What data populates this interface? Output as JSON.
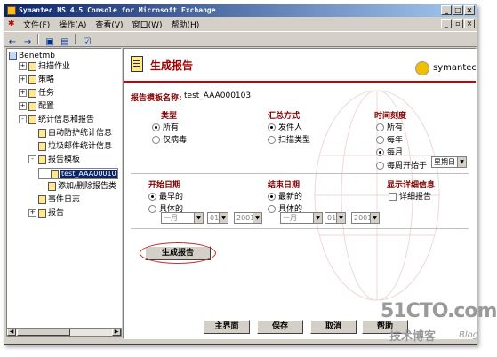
{
  "window": {
    "title": "Symantec MS 4.5 Console for Microsoft Exchange"
  },
  "menu": [
    "文件(F)",
    "操作(A)",
    "查看(V)",
    "窗口(W)",
    "帮助(H)"
  ],
  "tree": {
    "root": "Benetmb",
    "items": [
      {
        "label": "扫描作业",
        "exp": "+",
        "indent": 1
      },
      {
        "label": "策略",
        "exp": "+",
        "indent": 1
      },
      {
        "label": "任务",
        "exp": "+",
        "indent": 1
      },
      {
        "label": "配置",
        "exp": "+",
        "indent": 1
      },
      {
        "label": "统计信息和报告",
        "exp": "-",
        "indent": 1
      },
      {
        "label": "自动防护统计信息",
        "exp": "",
        "indent": 2
      },
      {
        "label": "垃圾邮件统计信息",
        "exp": "",
        "indent": 2
      },
      {
        "label": "报告模板",
        "exp": "-",
        "indent": 2
      },
      {
        "label": "test_AAA00010",
        "exp": "",
        "indent": 3
      },
      {
        "label": "添加/删除报告类",
        "exp": "",
        "indent": 3
      },
      {
        "label": "事件日志",
        "exp": "",
        "indent": 2
      },
      {
        "label": "报告",
        "exp": "+",
        "indent": 2
      }
    ]
  },
  "header": {
    "title": "生成报告",
    "brand": "symantec."
  },
  "template": {
    "label": "报告模板名称:",
    "value": "test_AAA000103"
  },
  "type_group": {
    "heading": "类型",
    "options": [
      "所有",
      "仅病毒"
    ]
  },
  "send_group": {
    "heading": "汇总方式",
    "options": [
      "发件人",
      "扫描类型"
    ]
  },
  "time_group": {
    "heading": "时间刻度",
    "options": [
      "所有",
      "每年",
      "每月",
      "每周开始于"
    ],
    "weekday": "星期日"
  },
  "start": {
    "heading": "开始日期",
    "options": [
      "最早的",
      "具体的"
    ],
    "month": "一月",
    "day": "01",
    "year": "2001"
  },
  "end": {
    "heading": "结束日期",
    "options": [
      "最新的",
      "具体的"
    ],
    "month": "一月",
    "day": "01",
    "year": "2001"
  },
  "detail": {
    "heading": "显示详细信息",
    "checkbox": "详细报告"
  },
  "generate_button": "生成报告",
  "bottom_buttons": [
    "主界面",
    "保存",
    "取消",
    "帮助"
  ],
  "watermark": {
    "site": "51CTO.com",
    "sub": "技术博客",
    "blog": "Blog"
  },
  "colors": {
    "accent": "#a00000",
    "titlebar": "#0a246a"
  }
}
